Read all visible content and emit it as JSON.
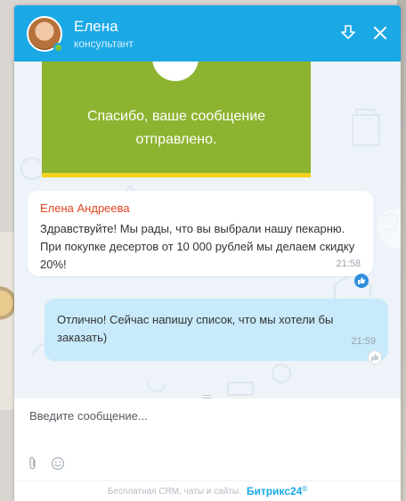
{
  "header": {
    "name": "Елена",
    "role": "консультант"
  },
  "chat": {
    "thanks_card": {
      "text_line1": "Спасибо, ваше сообщение",
      "text_line2": "отправлено."
    },
    "incoming": {
      "author": "Елена Андреева",
      "text": "Здравствуйте! Мы рады, что вы выбрали нашу пекарню. При покупке десертов от 10 000 рублей мы делаем скидку 20%!",
      "time": "21:58"
    },
    "outgoing": {
      "text": "Отлично! Сейчас напишу список, что мы хотели бы заказать)",
      "time": "21:59"
    }
  },
  "input": {
    "placeholder": "Введите сообщение..."
  },
  "footer": {
    "text": "Бесплатная CRM, чаты и сайты.",
    "brand": "Битрикс",
    "brand_num": "24",
    "brand_mark": "©"
  },
  "colors": {
    "header": "#1ba9e6",
    "thanks_card": "#8db430",
    "thanks_border": "#f3d11c",
    "outgoing_bubble": "#c8eafb",
    "author": "#e0451e"
  },
  "icons": [
    "minimize-icon",
    "close-icon",
    "like-icon",
    "attach-icon",
    "smile-icon"
  ]
}
